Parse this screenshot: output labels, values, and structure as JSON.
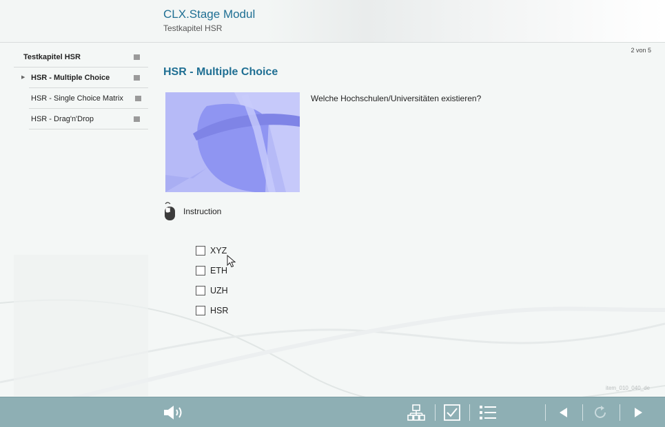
{
  "header": {
    "title": "CLX.Stage Modul",
    "subtitle": "Testkapitel HSR"
  },
  "sidebar": {
    "chapter": "Testkapitel HSR",
    "items": [
      {
        "label": "HSR - Multiple Choice",
        "active": true
      },
      {
        "label": "HSR - Single Choice Matrix",
        "active": false
      },
      {
        "label": "HSR - Drag'n'Drop",
        "active": false
      }
    ]
  },
  "page": {
    "counter": "2 von 5",
    "question_title": "HSR - Multiple Choice",
    "question_text": "Welche Hochschulen/Universitäten existieren?",
    "instruction_label": "Instruction",
    "options": [
      "XYZ",
      "ETH",
      "UZH",
      "HSR"
    ],
    "item_id": "item_010_040_de"
  },
  "footer": {
    "icons": [
      "speaker-icon",
      "sitemap-icon",
      "checkbox-icon",
      "list-icon",
      "prev-icon",
      "reload-icon",
      "next-icon"
    ]
  },
  "colors": {
    "accent": "#1f6f93",
    "footer": "#8eafb4",
    "background": "#f4f7f6"
  }
}
